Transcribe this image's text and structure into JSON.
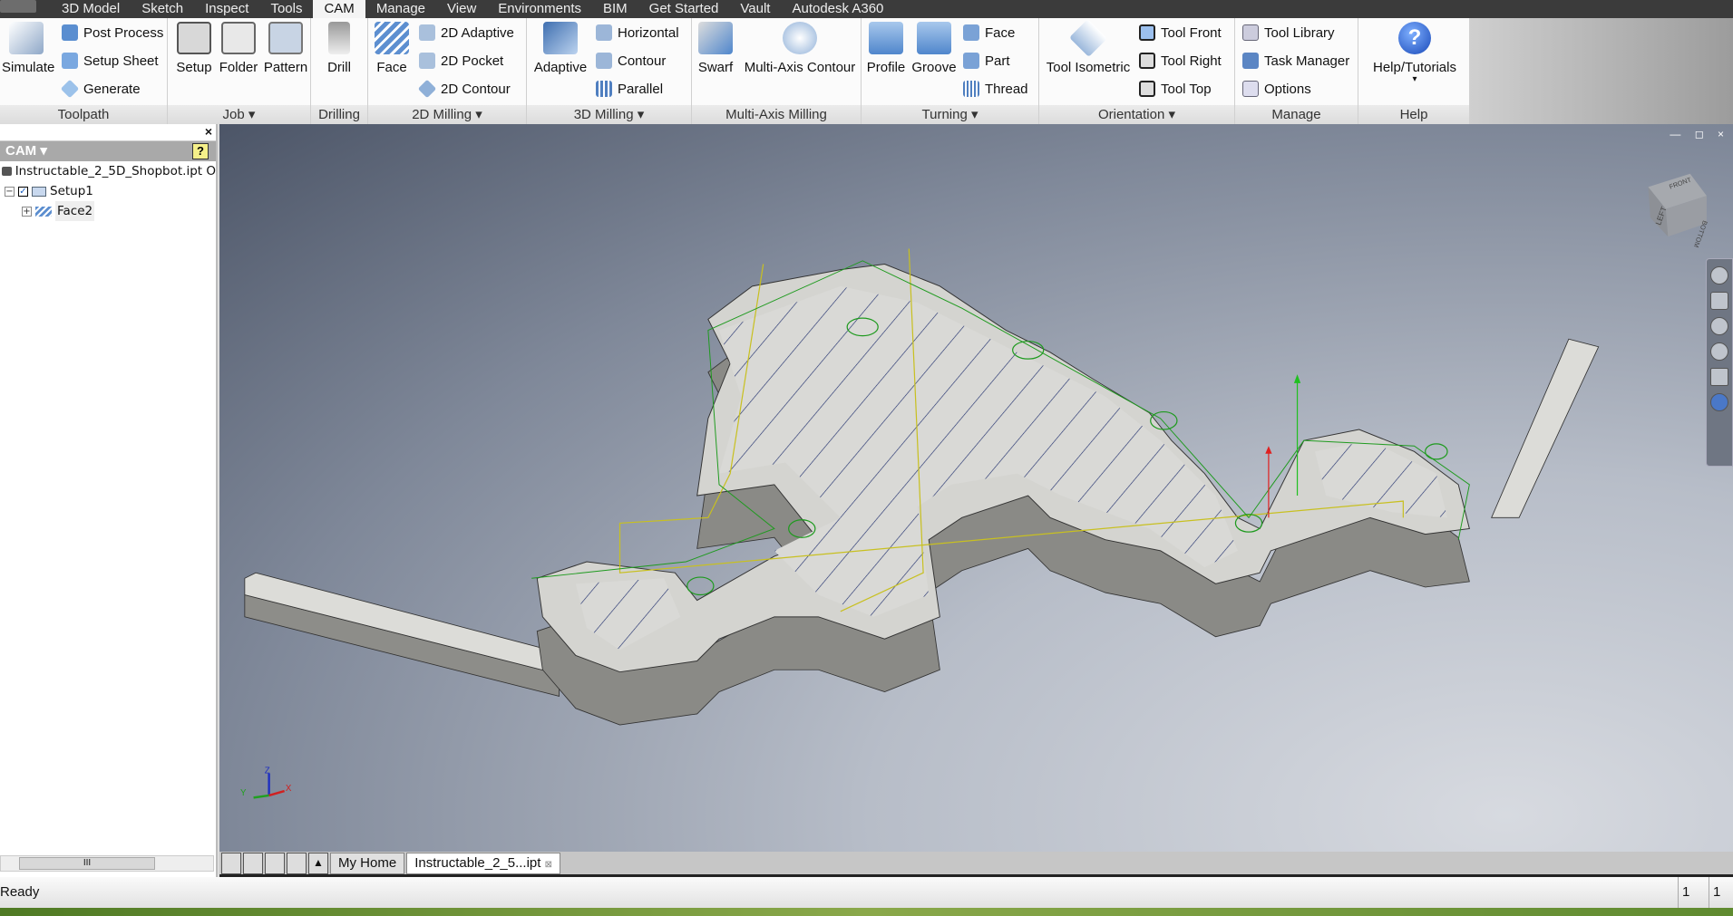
{
  "tabs": [
    "3D Model",
    "Sketch",
    "Inspect",
    "Tools",
    "CAM",
    "Manage",
    "View",
    "Environments",
    "BIM",
    "Get Started",
    "Vault",
    "Autodesk A360"
  ],
  "active_tab": "CAM",
  "ribbon": {
    "toolpath": {
      "label": "Toolpath",
      "simulate": "Simulate",
      "post_process": "Post Process",
      "setup_sheet": "Setup Sheet",
      "generate": "Generate"
    },
    "job": {
      "label": "Job ▾",
      "setup": "Setup",
      "folder": "Folder",
      "pattern": "Pattern"
    },
    "drilling": {
      "label": "Drilling",
      "drill": "Drill"
    },
    "milling2d": {
      "label": "2D Milling ▾",
      "face": "Face",
      "adaptive": "2D Adaptive",
      "pocket": "2D Pocket",
      "contour": "2D Contour"
    },
    "milling3d": {
      "label": "3D Milling ▾",
      "adaptive": "Adaptive",
      "horizontal": "Horizontal",
      "contour": "Contour",
      "parallel": "Parallel"
    },
    "multiaxis": {
      "label": "Multi-Axis Milling",
      "swarf": "Swarf",
      "contour": "Multi-Axis Contour"
    },
    "turning": {
      "label": "Turning ▾",
      "profile": "Profile",
      "groove": "Groove",
      "face": "Face",
      "part": "Part",
      "thread": "Thread"
    },
    "orientation": {
      "label": "Orientation ▾",
      "isometric": "Tool Isometric",
      "front": "Tool Front",
      "right": "Tool Right",
      "top": "Tool Top"
    },
    "manage": {
      "label": "Manage",
      "library": "Tool Library",
      "task_manager": "Task Manager",
      "options": "Options"
    },
    "help": {
      "label": "Help",
      "tutorials": "Help/Tutorials",
      "arrow": "▾"
    }
  },
  "browser": {
    "title": "CAM ▾",
    "help": "?",
    "close": "×",
    "root": "Instructable_2_5D_Shopbot.ipt O",
    "setup": "Setup1",
    "operation": "Face2",
    "scroll": "III"
  },
  "viewcube": {
    "left": "LEFT",
    "front": "FRONT",
    "bottom": "BOTTOM"
  },
  "doc_tabs": [
    "My Home",
    "Instructable_2_5...ipt"
  ],
  "status": {
    "text": "Ready",
    "count1": "1",
    "count2": "1"
  },
  "colors": {
    "accent": "#3b3b3b",
    "toolpath_green": "#1e9a1e",
    "toolpath_yellow": "#c8c020",
    "hatch": "#1a2a6a"
  }
}
